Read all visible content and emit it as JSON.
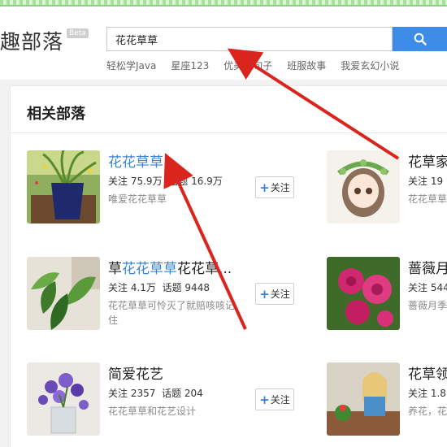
{
  "brand": {
    "logo_text": "趣部落",
    "beta_label": "Beta"
  },
  "search": {
    "query": "花花草草"
  },
  "hot_links": [
    "轻松学Java",
    "星座123",
    "优美的句子",
    "班服故事",
    "我爱玄幻小说"
  ],
  "section": {
    "title": "相关部落"
  },
  "tribes": [
    {
      "name_before": "",
      "name_highlight": "花花草草",
      "name_after": "",
      "follow_label": "关注",
      "follow_count": "75.9万",
      "topic_label": "话题",
      "topic_count": "16.9万",
      "desc": "唯爱花花草草",
      "follow_button": "关注"
    },
    {
      "name_before": "花草家",
      "name_highlight": "",
      "name_after": "",
      "follow_label": "关注",
      "follow_count": "19",
      "topic_label": "",
      "topic_count": "",
      "desc": "花花草草",
      "follow_button": ""
    },
    {
      "name_before": "草",
      "name_highlight": "花花草草",
      "name_after": "花花草...",
      "follow_label": "关注",
      "follow_count": "4.1万",
      "topic_label": "话题",
      "topic_count": "9448",
      "desc": "花花草草可怜灭了就赔咳咳记住",
      "follow_button": "关注"
    },
    {
      "name_before": "蔷薇月",
      "name_highlight": "",
      "name_after": "",
      "follow_label": "关注",
      "follow_count": "544",
      "topic_label": "",
      "topic_count": "",
      "desc": "蔷薇月季",
      "follow_button": ""
    },
    {
      "name_before": "简爱花艺",
      "name_highlight": "",
      "name_after": "",
      "follow_label": "关注",
      "follow_count": "2357",
      "topic_label": "话题",
      "topic_count": "204",
      "desc": "花花草草和花艺设计",
      "follow_button": "关注"
    },
    {
      "name_before": "花草领",
      "name_highlight": "",
      "name_after": "",
      "follow_label": "关注",
      "follow_count": "1.8",
      "topic_label": "",
      "topic_count": "",
      "desc": "养花，花",
      "follow_button": ""
    }
  ],
  "colors": {
    "accent": "#3c8ce8",
    "highlight": "#3a82d6",
    "arrow": "#d9251d"
  },
  "icons": {
    "search": "search-icon",
    "plus": "plus-icon"
  }
}
